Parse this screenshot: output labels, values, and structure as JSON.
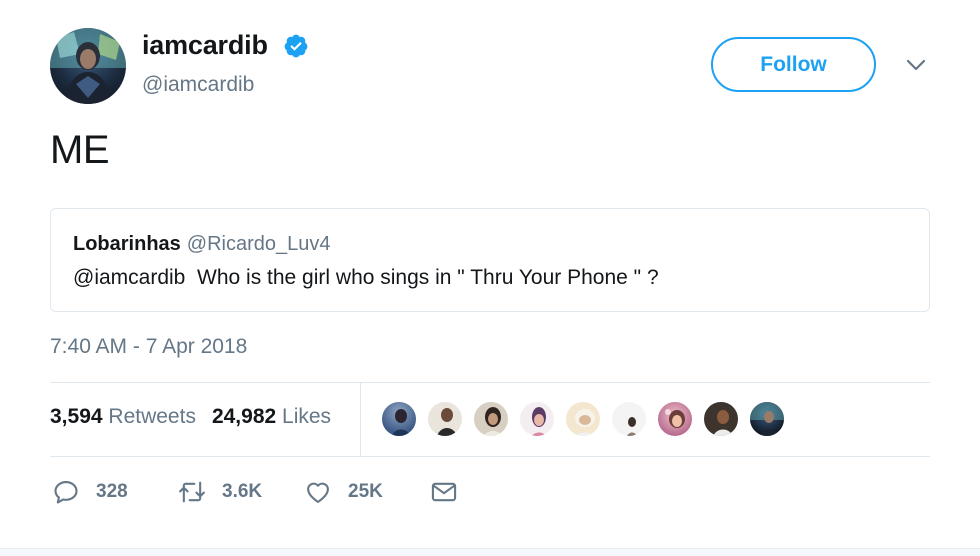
{
  "author": {
    "display_name": "iamcardib",
    "handle": "@iamcardib",
    "verified": true,
    "avatar_icon": "profile-avatar"
  },
  "follow_button": {
    "label": "Follow"
  },
  "menu_icon": "chevron-down-icon",
  "tweet": {
    "text": "ME"
  },
  "quoted_tweet": {
    "name": "Lobarinhas",
    "handle": "@Ricardo_Luv4",
    "text": "@iamcardib  Who is the girl who sings in \" Thru Your Phone \" ?"
  },
  "timestamp": "7:40 AM - 7 Apr 2018",
  "stats": {
    "retweets_count": "3,594",
    "retweets_label": "Retweets",
    "likes_count": "24,982",
    "likes_label": "Likes"
  },
  "likers": [
    {
      "name": "liker-avatar-1"
    },
    {
      "name": "liker-avatar-2"
    },
    {
      "name": "liker-avatar-3"
    },
    {
      "name": "liker-avatar-4"
    },
    {
      "name": "liker-avatar-5"
    },
    {
      "name": "liker-avatar-6"
    },
    {
      "name": "liker-avatar-7"
    },
    {
      "name": "liker-avatar-8"
    },
    {
      "name": "liker-avatar-9"
    }
  ],
  "actions": {
    "reply": {
      "icon": "reply-icon",
      "count": "328"
    },
    "retweet": {
      "icon": "retweet-icon",
      "count": "3.6K"
    },
    "like": {
      "icon": "heart-icon",
      "count": "25K"
    },
    "message": {
      "icon": "envelope-icon"
    }
  },
  "colors": {
    "accent": "#1da1f2",
    "secondary_text": "#657786",
    "border": "#e1e8ed"
  }
}
